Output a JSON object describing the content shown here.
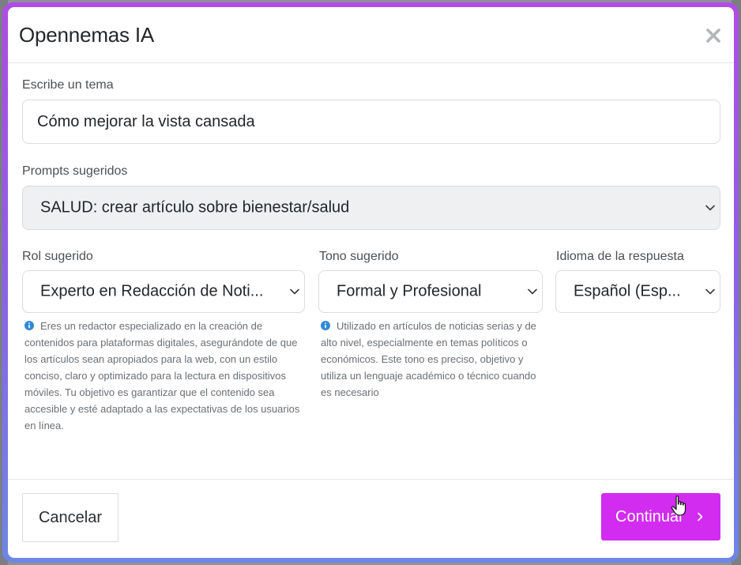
{
  "modal": {
    "title": "Opennemas IA"
  },
  "topic": {
    "label": "Escribe un tema",
    "value": "Cómo mejorar la vista cansada"
  },
  "prompts": {
    "label": "Prompts sugeridos",
    "selected": "SALUD: crear artículo sobre bienestar/salud"
  },
  "role": {
    "label": "Rol sugerido",
    "selected": "Experto en Redacción de Noti...",
    "help": "Eres un redactor especializado en la creación de contenidos para plataformas digitales, asegurándote de que los artículos sean apropiados para la web, con un estilo conciso, claro y optimizado para la lectura en dispositivos móviles. Tu objetivo es garantizar que el contenido sea accesible y esté adaptado a las expectativas de los usuarios en línea."
  },
  "tone": {
    "label": "Tono sugerido",
    "selected": "Formal y Profesional",
    "help": "Utilizado en artículos de noticias serias y de alto nivel, especialmente en temas políticos o económicos. Este tono es preciso, objetivo y utiliza un lenguaje académico o técnico cuando es necesario"
  },
  "language": {
    "label": "Idioma de la respuesta",
    "selected": "Español (Esp..."
  },
  "footer": {
    "cancel_label": "Cancelar",
    "continue_label": "Continuar"
  },
  "icons": {
    "close": "close-icon",
    "chevron": "chevron-down-icon",
    "info": "info-icon",
    "next": "chevron-right-icon"
  },
  "colors": {
    "accent": "#d22cf0",
    "info": "#2f8ad8"
  }
}
